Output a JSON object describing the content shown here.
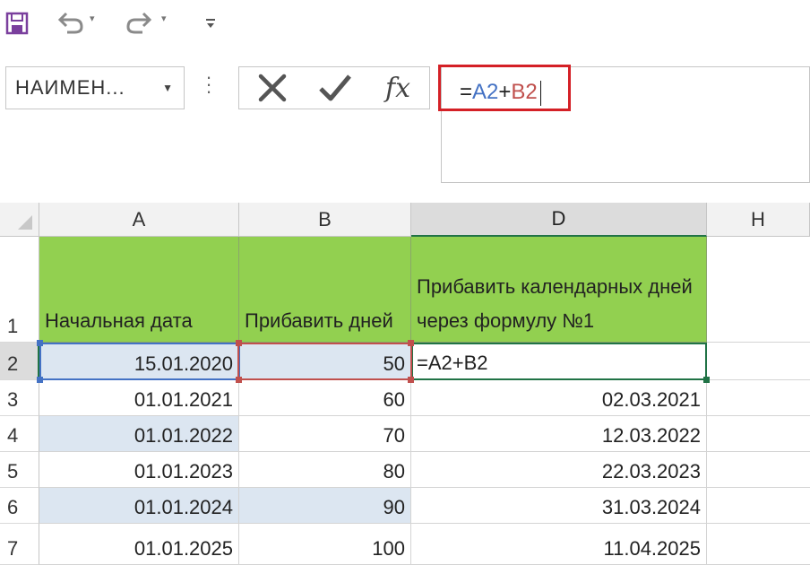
{
  "toolbar": {
    "save_icon": "save-icon",
    "undo_icon": "undo-icon",
    "redo_icon": "redo-icon",
    "customize_icon": "customize-qat-icon"
  },
  "formula_bar": {
    "name_box": "НАИМЕН...",
    "cancel_icon": "cancel-x-icon",
    "enter_icon": "check-icon",
    "fx_label": "fx",
    "formula": {
      "eq": "=",
      "ref1": "A2",
      "plus": "+",
      "ref2": "B2"
    }
  },
  "colors": {
    "header_fill": "#92d050",
    "ref_a": "#4472c4",
    "ref_b": "#c0504d",
    "highlight": "#d42026",
    "selection": "#217346"
  },
  "sheet": {
    "columns": [
      "A",
      "B",
      "D",
      "H"
    ],
    "rows": [
      "1",
      "2",
      "3",
      "4",
      "5",
      "6",
      "7"
    ],
    "header": {
      "a": "Начальная дата",
      "b": "Прибавить дней",
      "d": "Прибавить календарных дней через формулу №1"
    },
    "data": [
      {
        "a": "15.01.2020",
        "b": "50",
        "d": "=A2+B2"
      },
      {
        "a": "01.01.2021",
        "b": "60",
        "d": "02.03.2021"
      },
      {
        "a": "01.01.2022",
        "b": "70",
        "d": "12.03.2022"
      },
      {
        "a": "01.01.2023",
        "b": "80",
        "d": "22.03.2023"
      },
      {
        "a": "01.01.2024",
        "b": "90",
        "d": "31.03.2024"
      },
      {
        "a": "01.01.2025",
        "b": "100",
        "d": "11.04.2025"
      }
    ]
  }
}
